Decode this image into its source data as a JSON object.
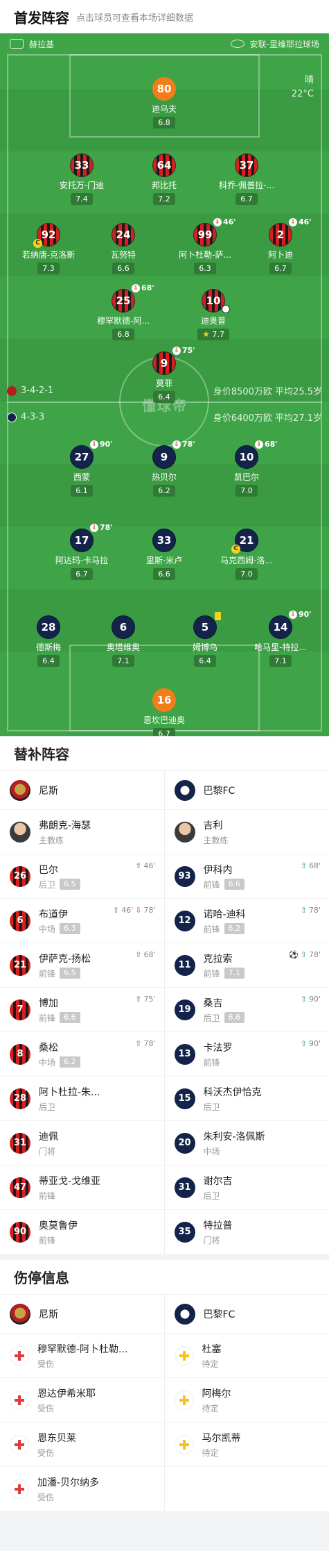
{
  "header": {
    "title": "首发阵容",
    "subtitle": "点击球员可查看本场详细数据"
  },
  "pitch": {
    "referee": "赫拉基",
    "stadium": "安联-里维耶拉球场",
    "weather": "晴",
    "temp": "22°C",
    "watermark": "懂球帝"
  },
  "home_team": {
    "formation": "3-4-2-1",
    "value": "身价8500万欧 平均25.5岁"
  },
  "away_team": {
    "formation": "4-3-3",
    "value": "身价6400万欧 平均27.1岁"
  },
  "home_players": [
    {
      "num": "80",
      "name": "迪乌夫",
      "rating": "6.8",
      "gk": true
    },
    {
      "num": "33",
      "name": "安托万-门迪",
      "rating": "7.4"
    },
    {
      "num": "64",
      "name": "邦比托",
      "rating": "7.2"
    },
    {
      "num": "37",
      "name": "科乔-佩普拉-...",
      "rating": "6.7"
    },
    {
      "num": "92",
      "name": "若纳唐-克洛斯",
      "rating": "7.3",
      "captain": true
    },
    {
      "num": "24",
      "name": "瓦努特",
      "rating": "6.6"
    },
    {
      "num": "99",
      "name": "阿卜杜勒-萨...",
      "rating": "6.3",
      "sub": "46'"
    },
    {
      "num": "2",
      "name": "阿卜迪",
      "rating": "6.7",
      "sub": "46'"
    },
    {
      "num": "25",
      "name": "穆罕默德-阿...",
      "rating": "6.8",
      "sub": "68'"
    },
    {
      "num": "10",
      "name": "迪奥普",
      "rating": "7.7",
      "star": true
    },
    {
      "num": "9",
      "name": "莫菲",
      "rating": "6.4",
      "sub": "75'"
    }
  ],
  "away_players": [
    {
      "num": "27",
      "name": "西蒙",
      "rating": "6.1",
      "sub": "90'"
    },
    {
      "num": "9",
      "name": "热贝尔",
      "rating": "6.2",
      "sub": "78'"
    },
    {
      "num": "10",
      "name": "凯巴尔",
      "rating": "7.0",
      "sub": "68'"
    },
    {
      "num": "17",
      "name": "阿达玛-卡马拉",
      "rating": "6.7",
      "sub": "78'"
    },
    {
      "num": "33",
      "name": "里斯-米卢",
      "rating": "6.6"
    },
    {
      "num": "21",
      "name": "马克西姆-洛...",
      "rating": "7.0",
      "captain": true
    },
    {
      "num": "28",
      "name": "德斯梅",
      "rating": "6.4"
    },
    {
      "num": "6",
      "name": "奥塔维奥",
      "rating": "7.1"
    },
    {
      "num": "5",
      "name": "姆博乌",
      "rating": "6.4",
      "yellow": true
    },
    {
      "num": "14",
      "name": "哈马里-特拉...",
      "rating": "7.1",
      "sub": "90'"
    },
    {
      "num": "16",
      "name": "恩坎巴迪奥",
      "rating": "6.7",
      "gk": true
    }
  ],
  "subs": {
    "title": "替补阵容",
    "home": {
      "team": "尼斯",
      "coach": "弗朗克-海瑟",
      "coach_role": "主教练",
      "players": [
        {
          "num": "26",
          "name": "巴尔",
          "pos": "后卫",
          "rating": "6.5",
          "in": "46'"
        },
        {
          "num": "6",
          "name": "布道伊",
          "pos": "中场",
          "rating": "6.3",
          "in": "46'",
          "out": "78'"
        },
        {
          "num": "21",
          "name": "伊萨克-扬松",
          "pos": "前锋",
          "rating": "6.5",
          "in": "68'"
        },
        {
          "num": "7",
          "name": "博加",
          "pos": "前锋",
          "rating": "6.6",
          "in": "75'"
        },
        {
          "num": "8",
          "name": "桑松",
          "pos": "中场",
          "rating": "6.2",
          "in": "78'"
        },
        {
          "num": "28",
          "name": "阿卜杜拉-朱...",
          "pos": "后卫"
        },
        {
          "num": "31",
          "name": "迪佩",
          "pos": "门将"
        },
        {
          "num": "47",
          "name": "蒂亚戈-戈维亚",
          "pos": "前锋"
        },
        {
          "num": "90",
          "name": "奥莫鲁伊",
          "pos": "前锋"
        }
      ]
    },
    "away": {
      "team": "巴黎FC",
      "coach": "吉利",
      "coach_role": "主教练",
      "players": [
        {
          "num": "93",
          "name": "伊科内",
          "pos": "前锋",
          "rating": "6.6",
          "in": "68'"
        },
        {
          "num": "12",
          "name": "诺哈-迪科",
          "pos": "前锋",
          "rating": "6.2",
          "in": "78'"
        },
        {
          "num": "11",
          "name": "克拉索",
          "pos": "前锋",
          "rating": "7.1",
          "in": "78'",
          "goal": true
        },
        {
          "num": "19",
          "name": "桑吉",
          "pos": "后卫",
          "rating": "6.6",
          "in": "90'"
        },
        {
          "num": "13",
          "name": "卡法罗",
          "pos": "前锋",
          "in": "90'"
        },
        {
          "num": "15",
          "name": "科沃杰伊恰克",
          "pos": "后卫"
        },
        {
          "num": "20",
          "name": "朱利安-洛佩斯",
          "pos": "中场"
        },
        {
          "num": "31",
          "name": "谢尔吉",
          "pos": "后卫"
        },
        {
          "num": "35",
          "name": "特拉普",
          "pos": "门将"
        }
      ]
    }
  },
  "injuries": {
    "title": "伤停信息",
    "home": {
      "team": "尼斯",
      "players": [
        {
          "name": "穆罕默德-阿卜杜勒...",
          "status": "受伤"
        },
        {
          "name": "恩达伊希米耶",
          "status": "受伤"
        },
        {
          "name": "恩东贝莱",
          "status": "受伤"
        },
        {
          "name": "加潘-贝尔纳多",
          "status": "受伤"
        }
      ]
    },
    "away": {
      "team": "巴黎FC",
      "players": [
        {
          "name": "杜塞",
          "status": "待定"
        },
        {
          "name": "阿梅尔",
          "status": "待定"
        },
        {
          "name": "马尔凯蒂",
          "status": "待定"
        }
      ]
    }
  },
  "colors": {
    "pitch": "#3fa447",
    "home": "#d62020",
    "away": "#13234a",
    "gk": "#f47c1a"
  }
}
